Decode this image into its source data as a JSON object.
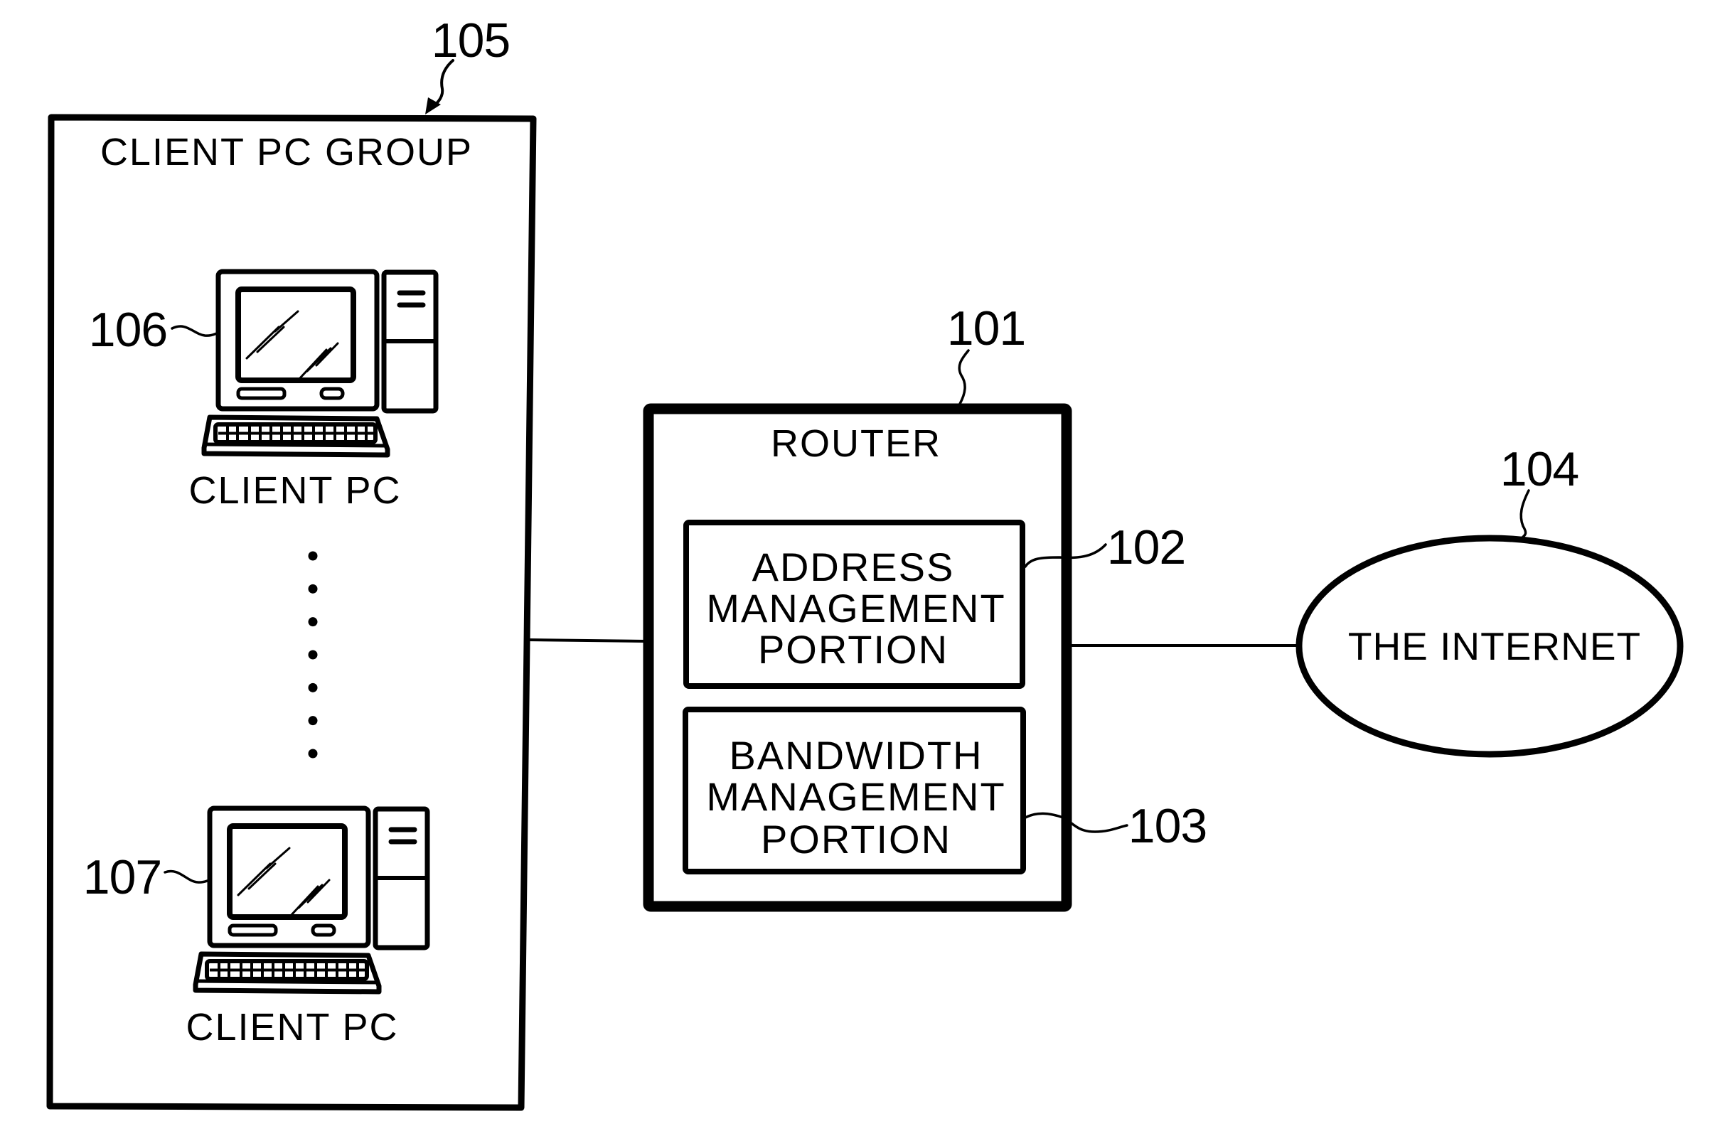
{
  "figure": {
    "client_group": {
      "ref": "105",
      "title": "CLIENT PC GROUP",
      "pcs": [
        {
          "ref": "106",
          "label": "CLIENT PC"
        },
        {
          "ref": "107",
          "label": "CLIENT PC"
        }
      ],
      "ellipsis_dot_count": 7
    },
    "router": {
      "ref": "101",
      "title": "ROUTER",
      "portions": [
        {
          "ref": "102",
          "lines": [
            "ADDRESS",
            "MANAGEMENT",
            "PORTION"
          ]
        },
        {
          "ref": "103",
          "lines": [
            "BANDWIDTH",
            "MANAGEMENT",
            "PORTION"
          ]
        }
      ]
    },
    "internet": {
      "ref": "104",
      "label": "THE INTERNET"
    },
    "connections": [
      {
        "from": "CLIENT PC GROUP",
        "to": "ROUTER"
      },
      {
        "from": "ROUTER",
        "to": "THE INTERNET"
      }
    ]
  }
}
